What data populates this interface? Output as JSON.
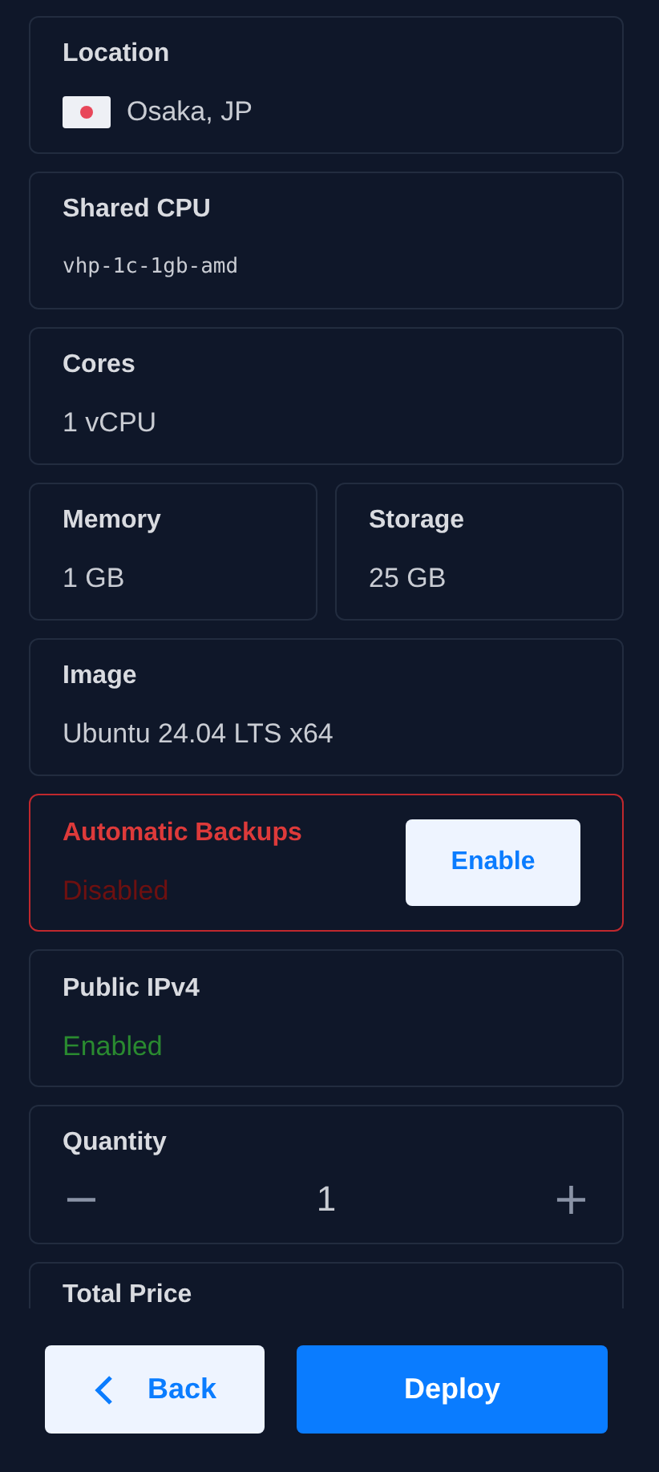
{
  "cards": [
    {
      "kind": "location",
      "title": "Location",
      "value": "Osaka, JP"
    },
    {
      "kind": "mono",
      "title": "Shared CPU",
      "value": "vhp-1c-1gb-amd"
    },
    {
      "kind": "plain",
      "title": "Cores",
      "value": "1 vCPU"
    },
    {
      "kind": "pair",
      "items": [
        {
          "title": "Memory",
          "value": "1 GB"
        },
        {
          "title": "Storage",
          "value": "25 GB"
        }
      ]
    },
    {
      "kind": "plain",
      "title": "Image",
      "value": "Ubuntu 24.04 LTS x64"
    },
    {
      "kind": "toggle",
      "title": "Automatic Backups",
      "value": "Disabled",
      "enabled": false,
      "action": "Enable"
    },
    {
      "kind": "toggle",
      "title": "Public IPv4",
      "value": "Enabled",
      "enabled": true
    },
    {
      "kind": "stepper",
      "title": "Quantity",
      "value": "1",
      "minus": "−",
      "plus": "+"
    },
    {
      "kind": "cut",
      "title": "Total Price"
    }
  ],
  "buttons": [
    {
      "kind": "back",
      "label": "Back"
    },
    {
      "kind": "primary",
      "label": "Deploy"
    }
  ]
}
